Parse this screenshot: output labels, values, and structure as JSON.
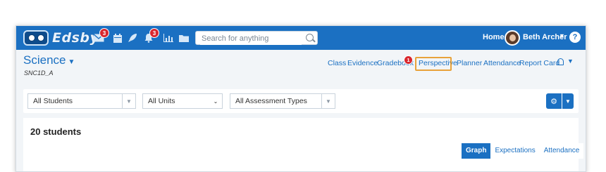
{
  "app": {
    "name": "Edsby"
  },
  "topbar": {
    "icons": [
      {
        "name": "mail-icon",
        "badge": "3"
      },
      {
        "name": "calendar-icon",
        "badge": ""
      },
      {
        "name": "rocket-icon",
        "badge": ""
      },
      {
        "name": "bell-icon",
        "badge": "3"
      },
      {
        "name": "chart-icon",
        "badge": ""
      },
      {
        "name": "folder-icon",
        "badge": ""
      }
    ],
    "search_placeholder": "Search for anything",
    "home_label": "Home",
    "user_name": "Beth Archer",
    "help_label": "?"
  },
  "course": {
    "title": "Science",
    "code": "SNC1D_A",
    "nav": [
      {
        "label": "Class",
        "badge": ""
      },
      {
        "label": "Evidence",
        "badge": ""
      },
      {
        "label": "Gradebook",
        "badge": "1"
      },
      {
        "label": "Perspective",
        "badge": "",
        "active": true
      },
      {
        "label": "Planner",
        "badge": ""
      },
      {
        "label": "Attendance",
        "badge": ""
      },
      {
        "label": "Report Card",
        "badge": ""
      }
    ]
  },
  "filters": {
    "students": "All Students",
    "units": "All Units",
    "assessment_types": "All Assessment Types"
  },
  "summary": {
    "student_count": "20 students",
    "view_tabs": [
      "Graph",
      "Expectations",
      "Attendance"
    ],
    "active_view": "Graph"
  },
  "colors": {
    "brand": "#1b70c2",
    "badge": "#d9272e",
    "highlight": "#e8a23a",
    "background": "#f2f5f8"
  }
}
